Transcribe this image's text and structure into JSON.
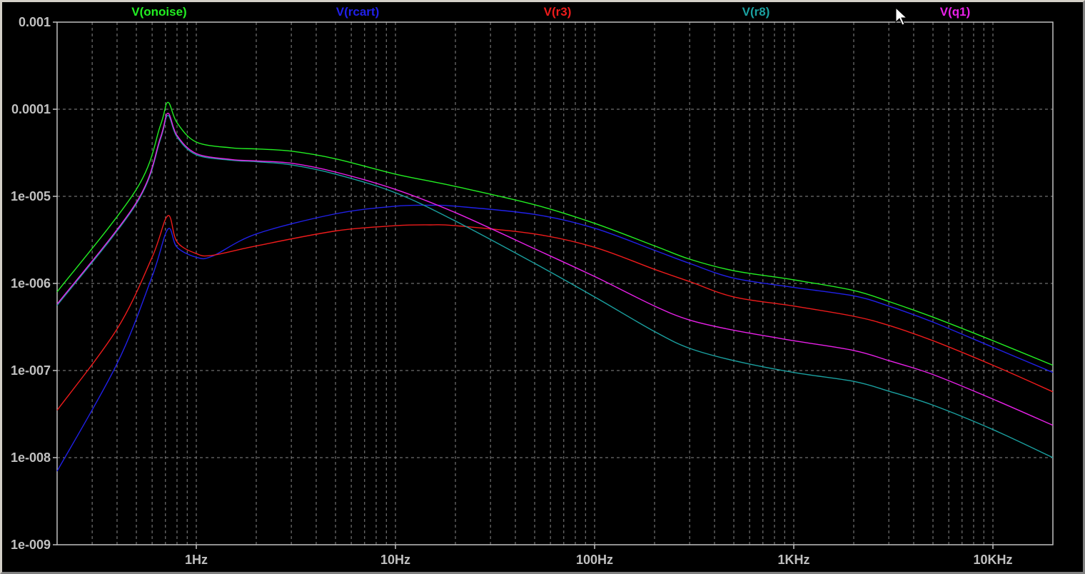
{
  "chart_data": {
    "type": "line",
    "x_scale": "log",
    "y_scale": "log",
    "xlim": [
      0.2,
      20000
    ],
    "ylim": [
      1e-09,
      0.001
    ],
    "grid": true,
    "legend_position": "top",
    "x_ticks": [
      {
        "value": 1,
        "label": "1Hz"
      },
      {
        "value": 10,
        "label": "10Hz"
      },
      {
        "value": 100,
        "label": "100Hz"
      },
      {
        "value": 1000,
        "label": "1KHz"
      },
      {
        "value": 10000,
        "label": "10KHz"
      }
    ],
    "y_ticks": [
      {
        "value": 0.001,
        "label": "0.001"
      },
      {
        "value": 0.0001,
        "label": "0.0001"
      },
      {
        "value": 1e-05,
        "label": "1e-005"
      },
      {
        "value": 1e-06,
        "label": "1e-006"
      },
      {
        "value": 1e-07,
        "label": "1e-007"
      },
      {
        "value": 1e-08,
        "label": "1e-008"
      },
      {
        "value": 1e-09,
        "label": "1e-009"
      }
    ],
    "series": [
      {
        "name": "V(onoise)",
        "color": "#22ee22",
        "x": [
          0.2,
          0.5,
          0.66,
          0.72,
          0.8,
          1,
          1.5,
          2,
          3,
          5,
          10,
          20,
          50,
          100,
          200,
          300,
          500,
          1000,
          2000,
          3000,
          5000,
          10000,
          20000
        ],
        "y": [
          8e-07,
          1.2e-05,
          6.5e-05,
          0.00012,
          7e-05,
          4.2e-05,
          3.6e-05,
          3.5e-05,
          3.3e-05,
          2.7e-05,
          1.8e-05,
          1.3e-05,
          8e-06,
          4.9e-06,
          2.7e-06,
          1.9e-06,
          1.4e-06,
          1.1e-06,
          8.3e-07,
          6.2e-07,
          4.1e-07,
          2.2e-07,
          1.15e-07
        ]
      },
      {
        "name": "V(rcart)",
        "color": "#2020e8",
        "x": [
          0.2,
          0.4,
          0.6,
          0.72,
          0.8,
          1,
          1.2,
          2,
          5,
          10,
          15,
          20,
          50,
          100,
          200,
          300,
          500,
          1000,
          2000,
          3000,
          5000,
          10000,
          20000
        ],
        "y": [
          7e-09,
          1.2e-07,
          1.2e-06,
          4.2e-06,
          2.6e-06,
          2e-06,
          2.05e-06,
          3.7e-06,
          6.3e-06,
          7.7e-06,
          7.9e-06,
          7.7e-06,
          6.2e-06,
          4.3e-06,
          2.4e-06,
          1.7e-06,
          1.15e-06,
          9e-07,
          7.2e-07,
          5.5e-07,
          3.6e-07,
          1.85e-07,
          9.5e-08
        ]
      },
      {
        "name": "V(r3)",
        "color": "#ee1b1b",
        "x": [
          0.2,
          0.4,
          0.6,
          0.72,
          0.8,
          1,
          1.2,
          2,
          5,
          10,
          15,
          20,
          50,
          100,
          200,
          300,
          500,
          1000,
          2000,
          3000,
          5000,
          10000,
          20000
        ],
        "y": [
          3.5e-08,
          3e-07,
          2e-06,
          6e-06,
          3e-06,
          2.2e-06,
          2.1e-06,
          2.7e-06,
          4e-06,
          4.6e-06,
          4.7e-06,
          4.6e-06,
          3.7e-06,
          2.6e-06,
          1.45e-06,
          1.05e-06,
          7e-07,
          5.5e-07,
          4.2e-07,
          3.3e-07,
          2.2e-07,
          1.15e-07,
          5.7e-08
        ]
      },
      {
        "name": "V(r8)",
        "color": "#1aa0a0",
        "x": [
          0.2,
          0.5,
          0.66,
          0.72,
          0.8,
          1,
          1.5,
          2,
          3,
          5,
          10,
          20,
          50,
          100,
          200,
          300,
          500,
          1000,
          2000,
          3000,
          5000,
          10000,
          20000
        ],
        "y": [
          5.6e-07,
          8.2e-06,
          4.5e-05,
          8.5e-05,
          4.8e-05,
          3e-05,
          2.6e-05,
          2.5e-05,
          2.3e-05,
          1.8e-05,
          1.1e-05,
          5.2e-06,
          1.7e-06,
          7e-07,
          2.8e-07,
          1.8e-07,
          1.3e-07,
          9.5e-08,
          7.5e-08,
          5.8e-08,
          4e-08,
          2.1e-08,
          1e-08
        ]
      },
      {
        "name": "V(q1)",
        "color": "#e820e8",
        "x": [
          0.2,
          0.5,
          0.66,
          0.72,
          0.8,
          1,
          1.5,
          2,
          3,
          5,
          10,
          20,
          50,
          100,
          200,
          300,
          500,
          1000,
          2000,
          3000,
          5000,
          10000,
          20000
        ],
        "y": [
          5.8e-07,
          8.5e-06,
          4.7e-05,
          9e-05,
          5e-05,
          3.1e-05,
          2.65e-05,
          2.55e-05,
          2.4e-05,
          1.9e-05,
          1.2e-05,
          6.5e-06,
          2.5e-06,
          1.2e-06,
          5.5e-07,
          3.8e-07,
          2.9e-07,
          2.2e-07,
          1.7e-07,
          1.3e-07,
          9e-08,
          4.7e-08,
          2.35e-08
        ]
      }
    ]
  }
}
